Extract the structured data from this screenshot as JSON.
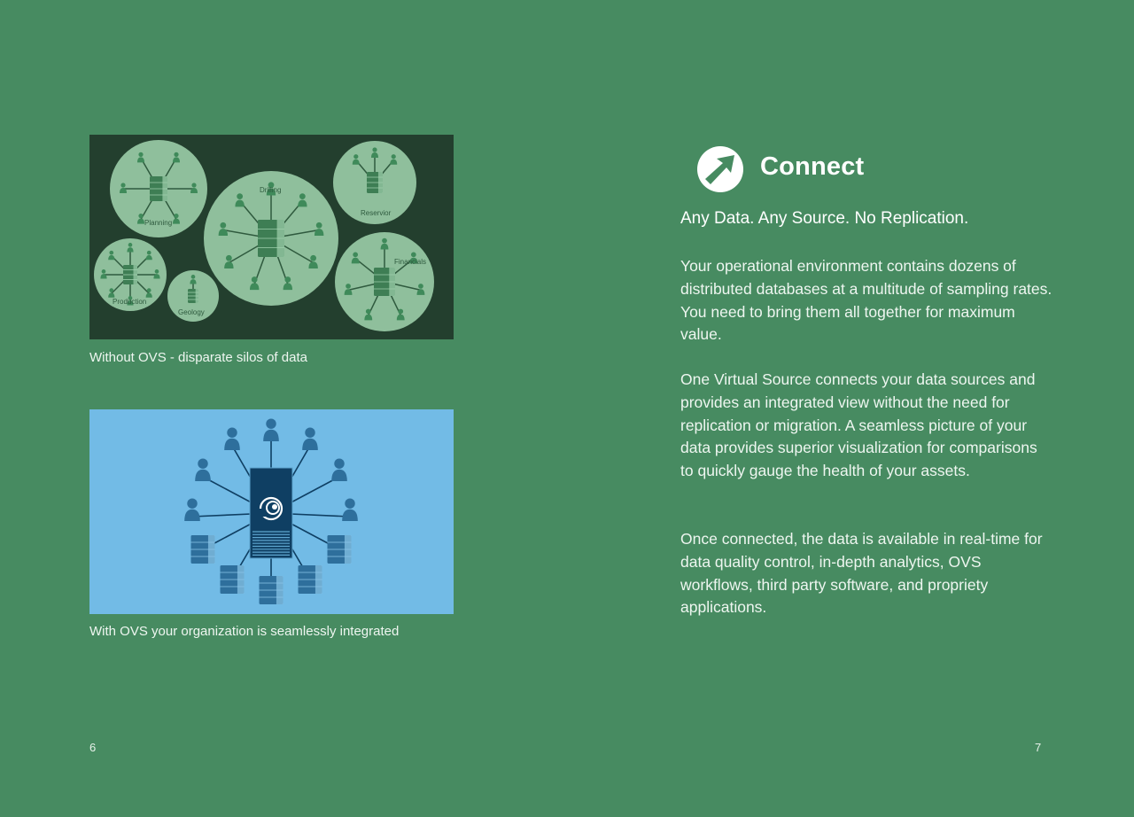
{
  "left_page": {
    "figure1": {
      "caption": "Without OVS - disparate silos of data",
      "silo_labels": {
        "planning": "Planning",
        "drilling": "Drilling",
        "reservior": "Reservior",
        "production": "Production",
        "geology": "Geology",
        "financials": "Financials"
      }
    },
    "figure2": {
      "caption": "With OVS your organization is seamlessly integrated"
    },
    "page_number": "6"
  },
  "right_page": {
    "icon": "arrow-up-right-icon",
    "title": "Connect",
    "tagline": "Any Data. Any Source. No Replication.",
    "paragraphs": [
      "Your operational environment contains dozens of distributed databases at a multitude of sampling rates. You need to bring them all together for maximum value.",
      "One Virtual Source connects your data sources and provides an integrated view without the need for replication or migration. A seamless picture of your data provides superior visualization for comparisons to quickly gauge the health of your assets.",
      "Once connected, the data is available in real-time for data quality control, in-depth analytics, OVS workflows, third party software, and propriety applications."
    ],
    "page_number": "7"
  },
  "colors": {
    "page_background": "#478b61",
    "figure1_background": "#233f2e",
    "figure1_circle": "#8fbf9c",
    "figure1_icon": "#3f8a5a",
    "figure2_background": "#72bbe6",
    "figure2_icon": "#2e6f9c",
    "figure2_server": "#0f3f63"
  }
}
